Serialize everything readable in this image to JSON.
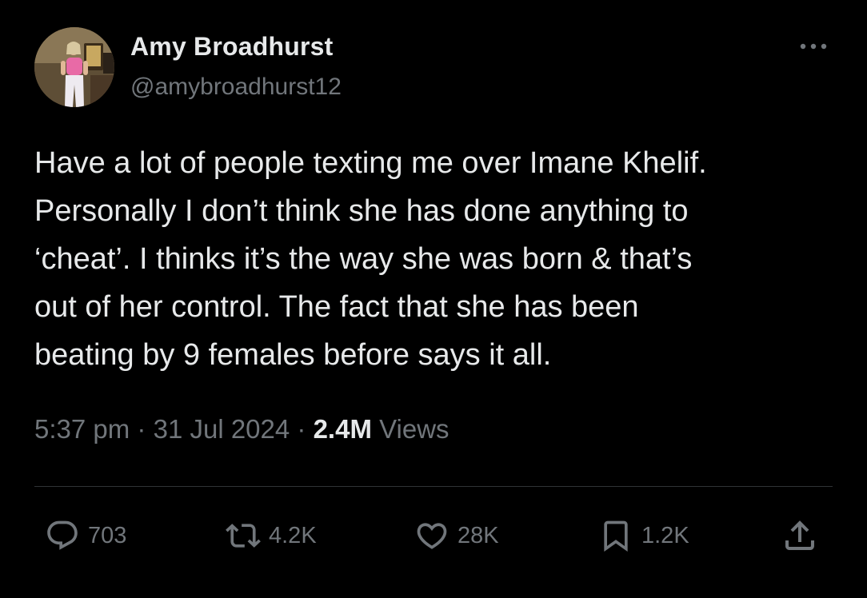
{
  "author": {
    "name": "Amy Broadhurst",
    "handle": "@amybroadhurst12"
  },
  "menu": {
    "icon": "more-horizontal-icon"
  },
  "tweet": {
    "lines": [
      "Have a lot of people texting me over Imane Khelif.",
      "Personally I don’t think she has done anything to",
      "‘cheat’. I thinks it’s the way she was born & that’s",
      "out of her control. The fact that she has been",
      "beating by 9 females before says it all."
    ],
    "time": "5:37 pm",
    "separator": "·",
    "date": "31 Jul 2024",
    "views_count": "2.4M",
    "views_label": "Views"
  },
  "actions": {
    "reply": {
      "icon": "reply-icon",
      "count": "703"
    },
    "retweet": {
      "icon": "retweet-icon",
      "count": "4.2K"
    },
    "like": {
      "icon": "heart-icon",
      "count": "28K"
    },
    "bookmark": {
      "icon": "bookmark-icon",
      "count": "1.2K"
    },
    "share": {
      "icon": "share-icon"
    }
  },
  "colors": {
    "background": "#000000",
    "primary_text": "#e7e9ea",
    "secondary_text": "#71767b",
    "divider": "#2f3336"
  }
}
